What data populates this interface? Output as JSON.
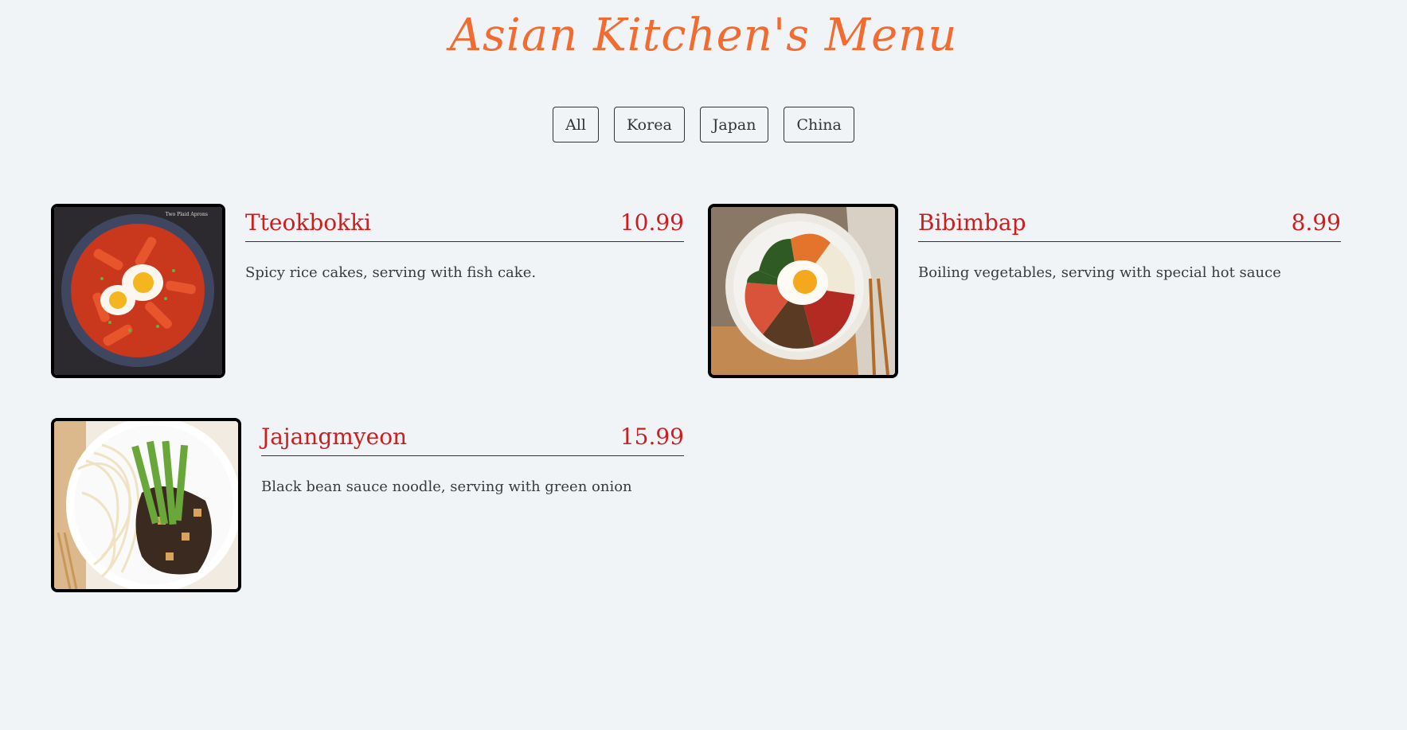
{
  "header": {
    "title": "Asian Kitchen's Menu"
  },
  "filters": [
    {
      "label": "All"
    },
    {
      "label": "Korea"
    },
    {
      "label": "Japan"
    },
    {
      "label": "China"
    }
  ],
  "menu": [
    {
      "name": "Tteokbokki",
      "price": "10.99",
      "description": "Spicy rice cakes, serving with fish cake.",
      "image_watermark": "Two Plaid Aprons"
    },
    {
      "name": "Bibimbap",
      "price": "8.99",
      "description": "Boiling vegetables, serving with special hot sauce"
    },
    {
      "name": "Jajangmyeon",
      "price": "15.99",
      "description": "Black bean sauce noodle, serving with green onion"
    }
  ],
  "colors": {
    "background": "#f0f4f7",
    "title": "#f26b30",
    "dish_text": "#cf1d1d"
  }
}
